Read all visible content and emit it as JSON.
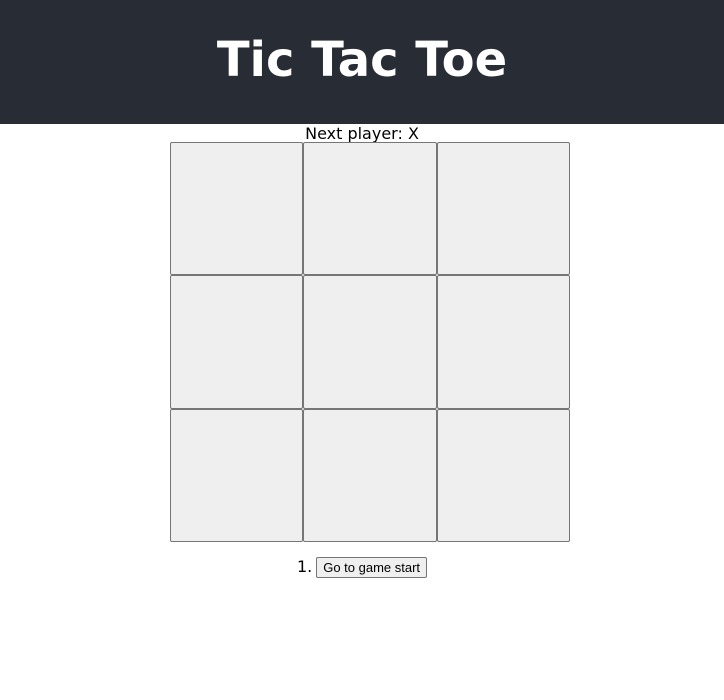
{
  "header": {
    "title": "Tic Tac Toe",
    "background": "#282c34"
  },
  "game": {
    "status": "Next player: X",
    "squares": [
      "",
      "",
      "",
      "",
      "",
      "",
      "",
      "",
      ""
    ]
  },
  "history": {
    "moves": [
      {
        "number": "1.",
        "label": "Go to game start"
      }
    ]
  }
}
